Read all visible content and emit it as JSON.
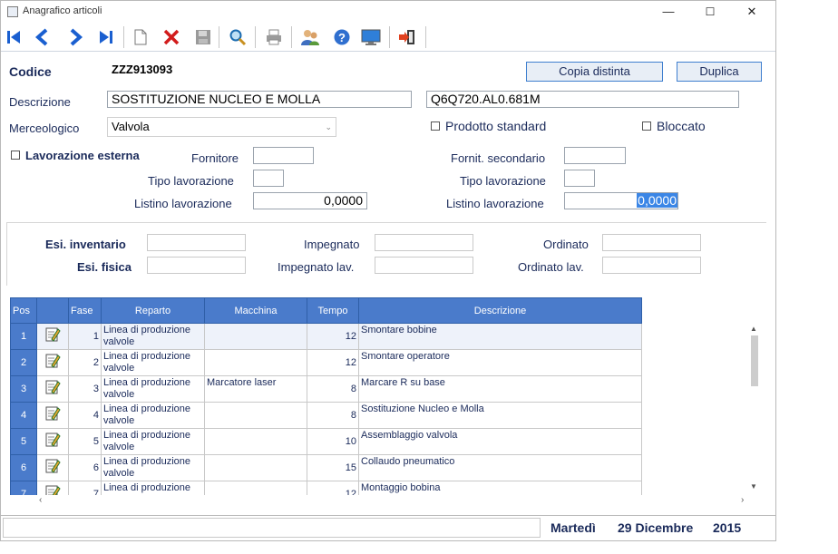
{
  "window": {
    "title": "Anagrafico articoli",
    "minimize": "—",
    "maximize": "☐",
    "close": "✕"
  },
  "header": {
    "codice_label": "Codice",
    "codice_value": "ZZZ913093",
    "copia_label": "Copia distinta",
    "duplica_label": "Duplica",
    "descrizione_label": "Descrizione",
    "descrizione_value": "SOSTITUZIONE NUCLEO E MOLLA",
    "descrizione2_value": "Q6Q720.AL0.681M",
    "merceologico_label": "Merceologico",
    "merceologico_value": "Valvola",
    "prodotto_standard_label": "Prodotto standard",
    "bloccato_label": "Bloccato"
  },
  "lavorazione": {
    "esterna_label": "Lavorazione esterna",
    "fornitore_label": "Fornitore",
    "fornitore_value": "",
    "tipo_label": "Tipo lavorazione",
    "tipo_value": "",
    "listino_label": "Listino lavorazione",
    "listino_value": "0,0000",
    "fornit_secondario_label": "Fornit. secondario",
    "fornit_secondario_value": "",
    "tipo2_label": "Tipo lavorazione",
    "tipo2_value": "",
    "listino2_label": "Listino lavorazione",
    "listino2_value": "0,0000"
  },
  "stock": {
    "esi_inventario_label": "Esi. inventario",
    "esi_fisica_label": "Esi. fisica",
    "impegnato_label": "Impegnato",
    "impegnato_lav_label": "Impegnato lav.",
    "ordinato_label": "Ordinato",
    "ordinato_lav_label": "Ordinato lav.",
    "esi_inventario": "",
    "esi_fisica": "",
    "impegnato": "",
    "impegnato_lav": "",
    "ordinato": "",
    "ordinato_lav": ""
  },
  "grid": {
    "columns": [
      "Pos",
      "",
      "Fase",
      "Reparto",
      "Macchina",
      "Tempo",
      "Descrizione"
    ],
    "rows": [
      {
        "pos": "1",
        "fase": "1",
        "reparto": "Linea di produzione valvole",
        "macchina": "",
        "tempo": "12",
        "descrizione": "Smontare bobine"
      },
      {
        "pos": "2",
        "fase": "2",
        "reparto": "Linea di produzione valvole",
        "macchina": "",
        "tempo": "12",
        "descrizione": "Smontare operatore"
      },
      {
        "pos": "3",
        "fase": "3",
        "reparto": "Linea di produzione valvole",
        "macchina": "Marcatore laser",
        "tempo": "8",
        "descrizione": "Marcare R su base"
      },
      {
        "pos": "4",
        "fase": "4",
        "reparto": "Linea di produzione valvole",
        "macchina": "",
        "tempo": "8",
        "descrizione": "Sostituzione Nucleo e Molla"
      },
      {
        "pos": "5",
        "fase": "5",
        "reparto": "Linea di produzione valvole",
        "macchina": "",
        "tempo": "10",
        "descrizione": "Assemblaggio valvola"
      },
      {
        "pos": "6",
        "fase": "6",
        "reparto": "Linea di produzione valvole",
        "macchina": "",
        "tempo": "15",
        "descrizione": "Collaudo pneumatico"
      },
      {
        "pos": "7",
        "fase": "7",
        "reparto": "Linea di produzione",
        "macchina": "",
        "tempo": "12",
        "descrizione": "Montaggio bobina"
      }
    ]
  },
  "status": {
    "day": "Martedì",
    "date": "29 Dicembre",
    "year": "2015"
  },
  "colors": {
    "header_blue": "#4a7bcb",
    "text": "#1a2a5a",
    "button_border": "#3f7fcf"
  }
}
